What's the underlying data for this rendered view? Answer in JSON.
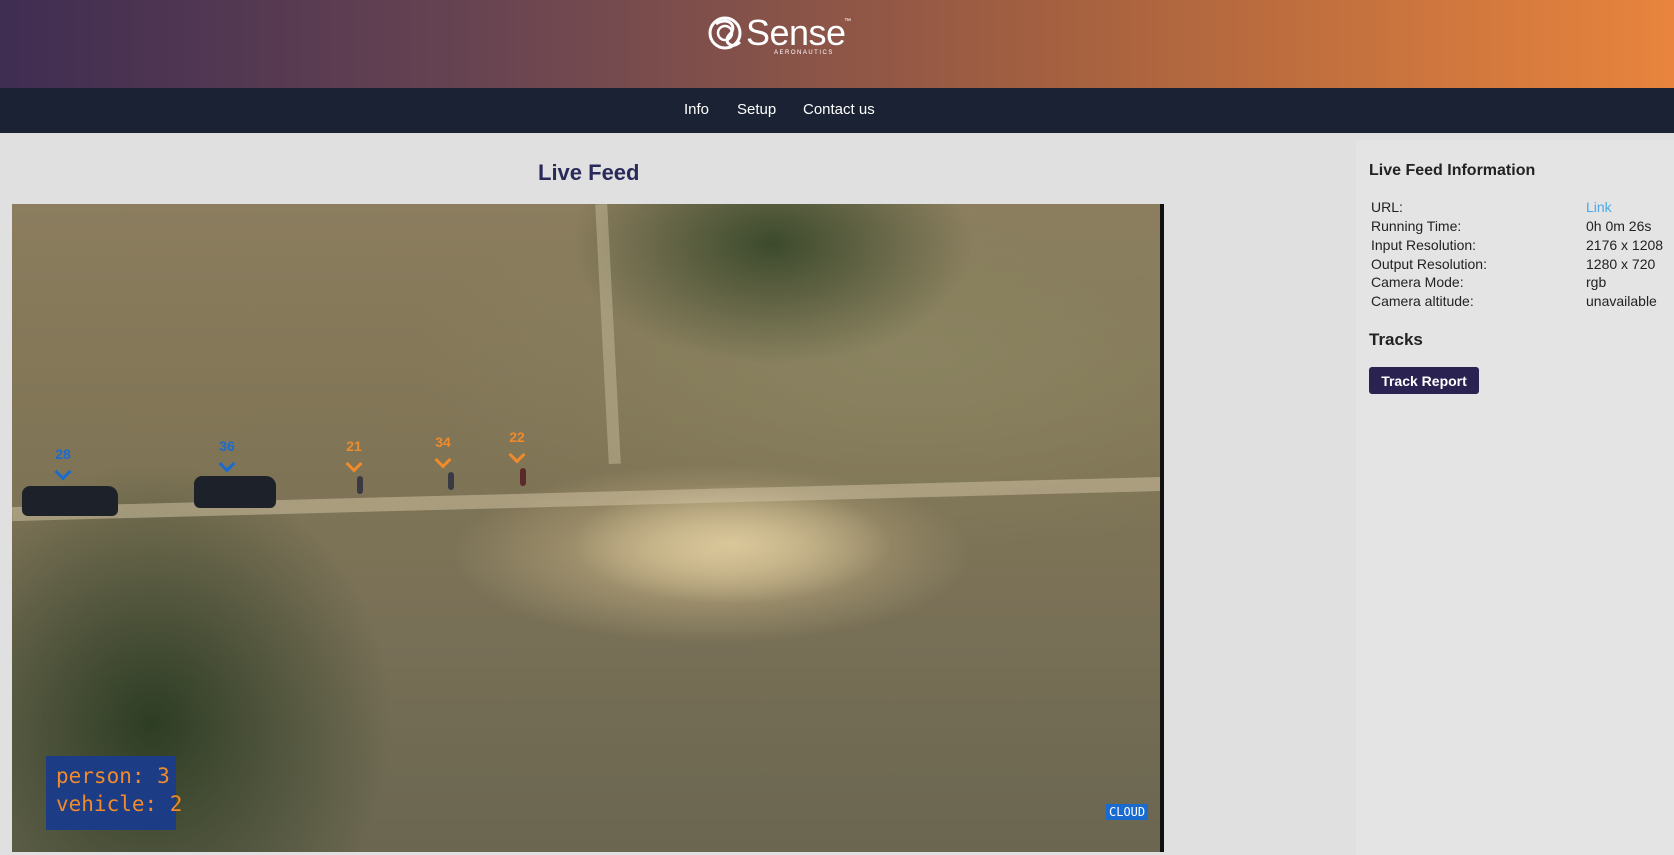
{
  "brand": {
    "name": "Sense",
    "tm": "™",
    "sub": "AERONAUTICS"
  },
  "nav": {
    "items": [
      {
        "label": "Info"
      },
      {
        "label": "Setup"
      },
      {
        "label": "Contact us"
      }
    ]
  },
  "main": {
    "title": "Live Feed",
    "video": {
      "tracks": [
        {
          "id": "28",
          "class": "vehicle",
          "color": "#1a6bd0"
        },
        {
          "id": "36",
          "class": "vehicle",
          "color": "#1a6bd0"
        },
        {
          "id": "21",
          "class": "person",
          "color": "#f08a2a"
        },
        {
          "id": "34",
          "class": "person",
          "color": "#f08a2a"
        },
        {
          "id": "22",
          "class": "person",
          "color": "#f08a2a"
        }
      ],
      "counts": {
        "person": "person: 3",
        "vehicle": "vehicle: 2"
      },
      "cloud_label": "CLOUD"
    }
  },
  "side": {
    "title": "Live Feed Information",
    "info": [
      {
        "key": "URL:",
        "value": "Link"
      },
      {
        "key": "Running Time:",
        "value": "0h 0m 26s"
      },
      {
        "key": "Input Resolution:",
        "value": "2176 x 1208"
      },
      {
        "key": "Output Resolution:",
        "value": "1280 x 720"
      },
      {
        "key": "Camera Mode:",
        "value": "rgb"
      },
      {
        "key": "Camera altitude:",
        "value": "unavailable"
      }
    ],
    "tracks_title": "Tracks",
    "track_report_label": "Track Report"
  }
}
